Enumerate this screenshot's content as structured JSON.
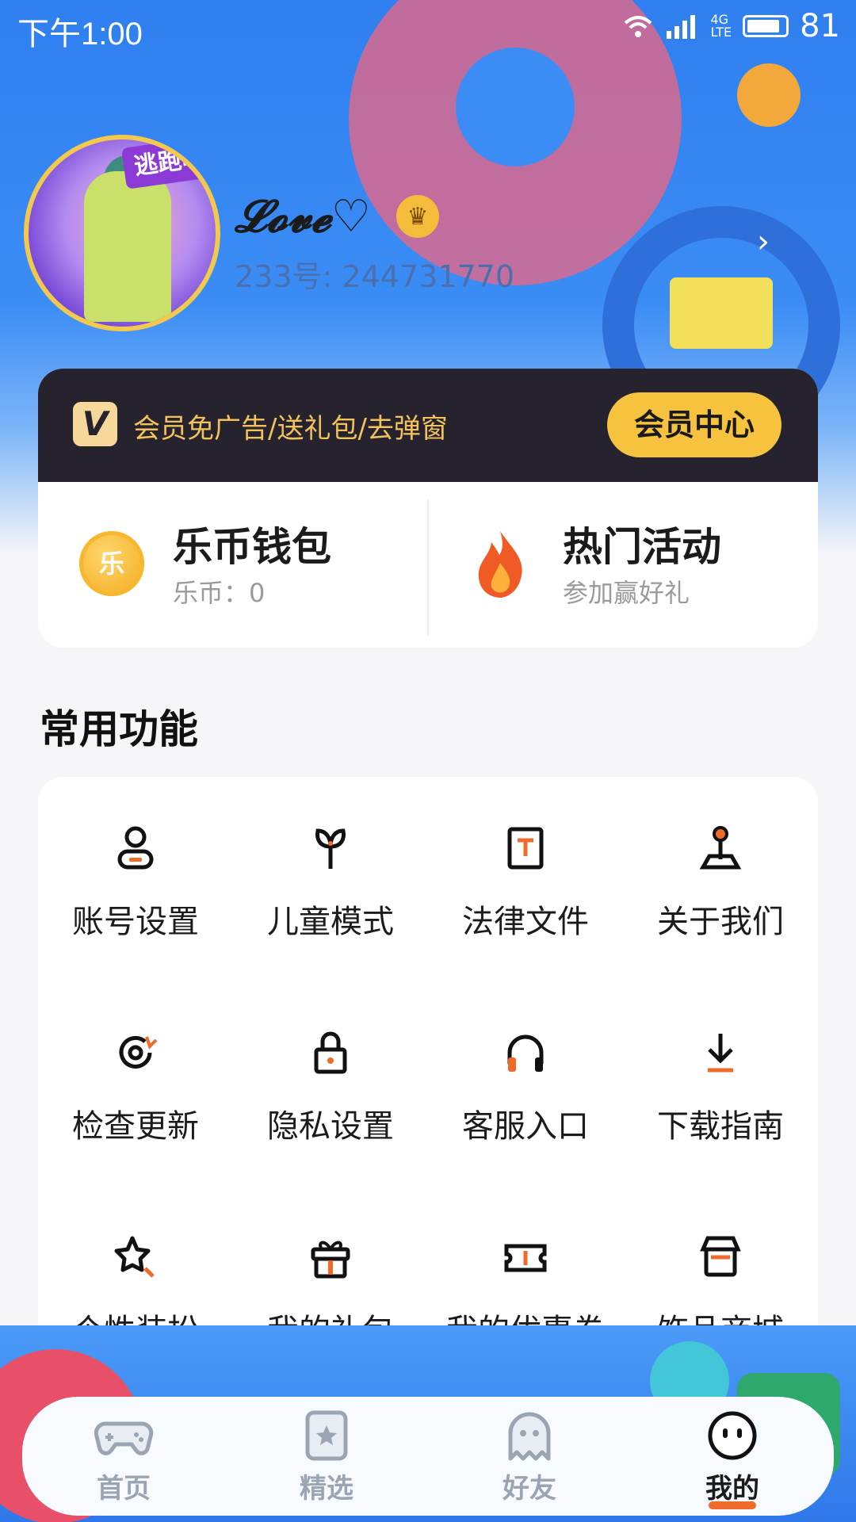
{
  "status_bar": {
    "time": "下午1:00",
    "battery": "81"
  },
  "profile": {
    "name": "𝓛𝓸𝓿𝓮♡",
    "uid": "233号: 244731770",
    "avatar_tag": "逃跑吧!"
  },
  "vip": {
    "logo": "V",
    "text": "会员免广告/送礼包/去弹窗",
    "button": "会员中心"
  },
  "quick": [
    {
      "title": "乐币钱包",
      "sub": "乐币：0",
      "icon": "coin-icon",
      "coin_label": "乐"
    },
    {
      "title": "热门活动",
      "sub": "参加赢好礼",
      "icon": "flame-icon"
    }
  ],
  "section_title": "常用功能",
  "functions": [
    {
      "label": "账号设置",
      "icon": "user-icon"
    },
    {
      "label": "儿童模式",
      "icon": "sprout-icon"
    },
    {
      "label": "法律文件",
      "icon": "document-icon"
    },
    {
      "label": "关于我们",
      "icon": "joystick-icon"
    },
    {
      "label": "检查更新",
      "icon": "refresh-icon"
    },
    {
      "label": "隐私设置",
      "icon": "lock-icon"
    },
    {
      "label": "客服入口",
      "icon": "headphones-icon"
    },
    {
      "label": "下载指南",
      "icon": "download-icon"
    },
    {
      "label": "个性装扮",
      "icon": "star-icon"
    },
    {
      "label": "我的礼包",
      "icon": "gift-icon"
    },
    {
      "label": "我的优惠券",
      "icon": "ticket-icon"
    },
    {
      "label": "饰品商城",
      "icon": "shop-icon"
    }
  ],
  "tabs": [
    {
      "label": "首页",
      "icon": "gamepad-icon",
      "active": false
    },
    {
      "label": "精选",
      "icon": "star-bookmark-icon",
      "active": false
    },
    {
      "label": "好友",
      "icon": "ghost-icon",
      "active": false
    },
    {
      "label": "我的",
      "icon": "smiley-icon",
      "active": true
    }
  ],
  "colors": {
    "accent": "#f7c33f",
    "orange": "#f06a2a",
    "hero_blue": "#3b8df5",
    "vip_dark": "#26232e"
  }
}
